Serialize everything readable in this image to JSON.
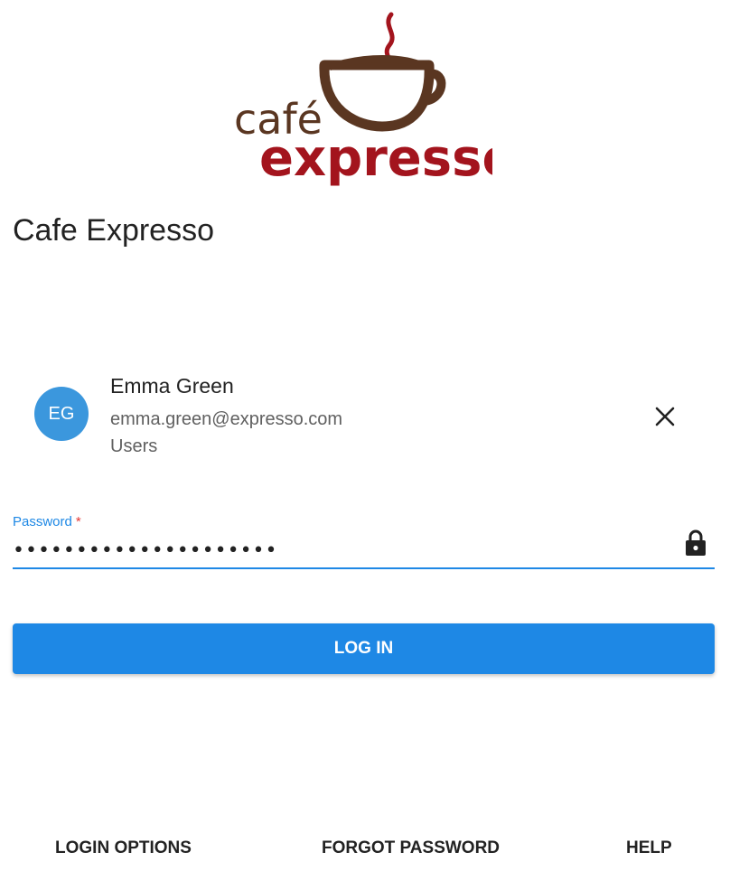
{
  "brand": {
    "logo_line1": "café",
    "logo_line2": "expresso",
    "title": "Cafe Expresso"
  },
  "colors": {
    "accent": "#1e88e5",
    "avatar_bg": "#3b97dd",
    "logo_brown": "#5a3621",
    "logo_red": "#a3141d",
    "required": "#e53935"
  },
  "account": {
    "initials": "EG",
    "name": "Emma Green",
    "email": "emma.green@expresso.com",
    "group": "Users",
    "remove_icon": "close-icon"
  },
  "password": {
    "label": "Password",
    "required_marker": "*",
    "value": "•••••••••••••••••••••",
    "trailing_icon": "lock-icon"
  },
  "actions": {
    "login_label": "LOG IN"
  },
  "footer": {
    "login_options": "LOGIN OPTIONS",
    "forgot_password": "FORGOT PASSWORD",
    "help": "HELP"
  }
}
